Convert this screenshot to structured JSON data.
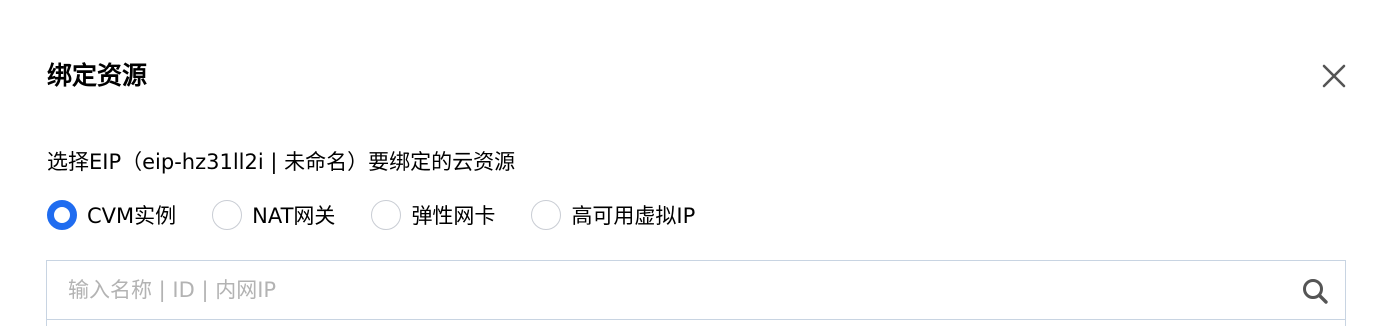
{
  "dialog": {
    "title": "绑定资源",
    "close_icon": "close-icon"
  },
  "description": "选择EIP（eip-hz31ll2i | 未命名）要绑定的云资源",
  "resource_types": [
    {
      "label": "CVM实例",
      "checked": true
    },
    {
      "label": "NAT网关",
      "checked": false
    },
    {
      "label": "弹性网卡",
      "checked": false
    },
    {
      "label": "高可用虚拟IP",
      "checked": false
    }
  ],
  "search": {
    "placeholder": "输入名称 | ID | 内网IP",
    "value": "",
    "icon": "search-icon"
  },
  "colors": {
    "accent": "#1f6cf0",
    "border": "#c8d4e2",
    "placeholder": "#b3b3b3"
  }
}
